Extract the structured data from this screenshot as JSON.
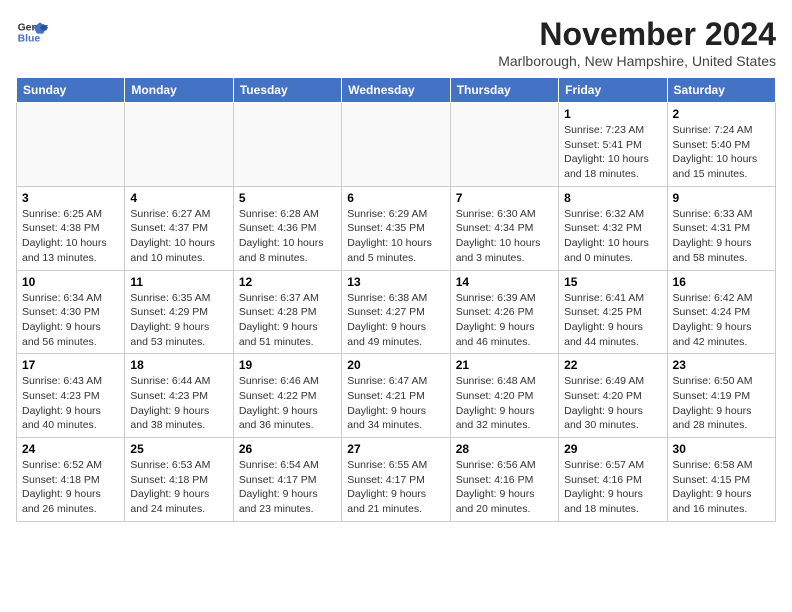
{
  "header": {
    "logo_line1": "General",
    "logo_line2": "Blue",
    "month_year": "November 2024",
    "location": "Marlborough, New Hampshire, United States"
  },
  "weekdays": [
    "Sunday",
    "Monday",
    "Tuesday",
    "Wednesday",
    "Thursday",
    "Friday",
    "Saturday"
  ],
  "weeks": [
    [
      {
        "day": "",
        "info": ""
      },
      {
        "day": "",
        "info": ""
      },
      {
        "day": "",
        "info": ""
      },
      {
        "day": "",
        "info": ""
      },
      {
        "day": "",
        "info": ""
      },
      {
        "day": "1",
        "info": "Sunrise: 7:23 AM\nSunset: 5:41 PM\nDaylight: 10 hours and 18 minutes."
      },
      {
        "day": "2",
        "info": "Sunrise: 7:24 AM\nSunset: 5:40 PM\nDaylight: 10 hours and 15 minutes."
      }
    ],
    [
      {
        "day": "3",
        "info": "Sunrise: 6:25 AM\nSunset: 4:38 PM\nDaylight: 10 hours and 13 minutes."
      },
      {
        "day": "4",
        "info": "Sunrise: 6:27 AM\nSunset: 4:37 PM\nDaylight: 10 hours and 10 minutes."
      },
      {
        "day": "5",
        "info": "Sunrise: 6:28 AM\nSunset: 4:36 PM\nDaylight: 10 hours and 8 minutes."
      },
      {
        "day": "6",
        "info": "Sunrise: 6:29 AM\nSunset: 4:35 PM\nDaylight: 10 hours and 5 minutes."
      },
      {
        "day": "7",
        "info": "Sunrise: 6:30 AM\nSunset: 4:34 PM\nDaylight: 10 hours and 3 minutes."
      },
      {
        "day": "8",
        "info": "Sunrise: 6:32 AM\nSunset: 4:32 PM\nDaylight: 10 hours and 0 minutes."
      },
      {
        "day": "9",
        "info": "Sunrise: 6:33 AM\nSunset: 4:31 PM\nDaylight: 9 hours and 58 minutes."
      }
    ],
    [
      {
        "day": "10",
        "info": "Sunrise: 6:34 AM\nSunset: 4:30 PM\nDaylight: 9 hours and 56 minutes."
      },
      {
        "day": "11",
        "info": "Sunrise: 6:35 AM\nSunset: 4:29 PM\nDaylight: 9 hours and 53 minutes."
      },
      {
        "day": "12",
        "info": "Sunrise: 6:37 AM\nSunset: 4:28 PM\nDaylight: 9 hours and 51 minutes."
      },
      {
        "day": "13",
        "info": "Sunrise: 6:38 AM\nSunset: 4:27 PM\nDaylight: 9 hours and 49 minutes."
      },
      {
        "day": "14",
        "info": "Sunrise: 6:39 AM\nSunset: 4:26 PM\nDaylight: 9 hours and 46 minutes."
      },
      {
        "day": "15",
        "info": "Sunrise: 6:41 AM\nSunset: 4:25 PM\nDaylight: 9 hours and 44 minutes."
      },
      {
        "day": "16",
        "info": "Sunrise: 6:42 AM\nSunset: 4:24 PM\nDaylight: 9 hours and 42 minutes."
      }
    ],
    [
      {
        "day": "17",
        "info": "Sunrise: 6:43 AM\nSunset: 4:23 PM\nDaylight: 9 hours and 40 minutes."
      },
      {
        "day": "18",
        "info": "Sunrise: 6:44 AM\nSunset: 4:23 PM\nDaylight: 9 hours and 38 minutes."
      },
      {
        "day": "19",
        "info": "Sunrise: 6:46 AM\nSunset: 4:22 PM\nDaylight: 9 hours and 36 minutes."
      },
      {
        "day": "20",
        "info": "Sunrise: 6:47 AM\nSunset: 4:21 PM\nDaylight: 9 hours and 34 minutes."
      },
      {
        "day": "21",
        "info": "Sunrise: 6:48 AM\nSunset: 4:20 PM\nDaylight: 9 hours and 32 minutes."
      },
      {
        "day": "22",
        "info": "Sunrise: 6:49 AM\nSunset: 4:20 PM\nDaylight: 9 hours and 30 minutes."
      },
      {
        "day": "23",
        "info": "Sunrise: 6:50 AM\nSunset: 4:19 PM\nDaylight: 9 hours and 28 minutes."
      }
    ],
    [
      {
        "day": "24",
        "info": "Sunrise: 6:52 AM\nSunset: 4:18 PM\nDaylight: 9 hours and 26 minutes."
      },
      {
        "day": "25",
        "info": "Sunrise: 6:53 AM\nSunset: 4:18 PM\nDaylight: 9 hours and 24 minutes."
      },
      {
        "day": "26",
        "info": "Sunrise: 6:54 AM\nSunset: 4:17 PM\nDaylight: 9 hours and 23 minutes."
      },
      {
        "day": "27",
        "info": "Sunrise: 6:55 AM\nSunset: 4:17 PM\nDaylight: 9 hours and 21 minutes."
      },
      {
        "day": "28",
        "info": "Sunrise: 6:56 AM\nSunset: 4:16 PM\nDaylight: 9 hours and 20 minutes."
      },
      {
        "day": "29",
        "info": "Sunrise: 6:57 AM\nSunset: 4:16 PM\nDaylight: 9 hours and 18 minutes."
      },
      {
        "day": "30",
        "info": "Sunrise: 6:58 AM\nSunset: 4:15 PM\nDaylight: 9 hours and 16 minutes."
      }
    ]
  ]
}
